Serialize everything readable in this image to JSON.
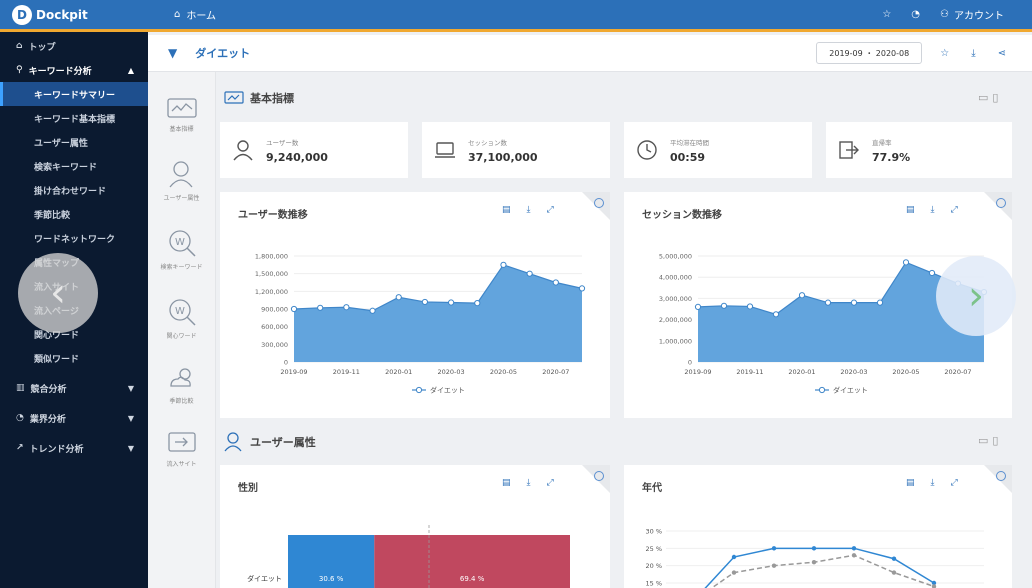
{
  "topbar": {
    "logo": "Dockpit",
    "home_label": "ホーム",
    "account_label": "アカウント"
  },
  "sidebar": {
    "items": [
      {
        "label": "トップ"
      },
      {
        "label": "キーワード分析"
      }
    ],
    "subitems": [
      "キーワードサマリー",
      "キーワード基本指標",
      "ユーザー属性",
      "検索キーワード",
      "掛け合わせワード",
      "季節比較",
      "ワードネットワーク",
      "属性マップ",
      "流入サイト",
      "流入ページ",
      "関心ワード",
      "類似ワード"
    ],
    "bottom_items": [
      "競合分析",
      "業界分析",
      "トレンド分析"
    ]
  },
  "subheader": {
    "keyword": "ダイエット",
    "date_range": "2019-09 ・ 2020-08"
  },
  "rail": [
    "基本指標",
    "ユーザー属性",
    "検索キーワード",
    "関心ワード",
    "季節比較",
    "流入サイト"
  ],
  "section1": {
    "title": "基本指標"
  },
  "metrics": [
    {
      "label": "ユーザー数",
      "value": "9,240,000"
    },
    {
      "label": "セッション数",
      "value": "37,100,000"
    },
    {
      "label": "平均滞在時間",
      "value": "00:59"
    },
    {
      "label": "直帰率",
      "value": "77.9%"
    }
  ],
  "card_users": {
    "title": "ユーザー数推移"
  },
  "card_sessions": {
    "title": "セッション数推移"
  },
  "section2": {
    "title": "ユーザー属性"
  },
  "card_gender": {
    "title": "性別"
  },
  "card_age": {
    "title": "年代"
  },
  "chart_data": [
    {
      "type": "area",
      "title": "ユーザー数推移",
      "x": [
        "2019-09",
        "2019-10",
        "2019-11",
        "2019-12",
        "2020-01",
        "2020-02",
        "2020-03",
        "2020-04",
        "2020-05",
        "2020-06",
        "2020-07",
        "2020-08"
      ],
      "x_tick_labels": [
        "2019-09",
        "2019-11",
        "2020-01",
        "2020-03",
        "2020-05",
        "2020-07"
      ],
      "y_tick_labels": [
        "0",
        "300,000",
        "600,000",
        "900,000",
        "1,200,000",
        "1,500,000",
        "1,800,000"
      ],
      "ylim": [
        0,
        1800000
      ],
      "series": [
        {
          "name": "ダイエット",
          "values": [
            900000,
            920000,
            930000,
            870000,
            1100000,
            1020000,
            1010000,
            1000000,
            1650000,
            1500000,
            1350000,
            1250000
          ]
        }
      ],
      "color": "#5a9fdb",
      "legend": "bottom"
    },
    {
      "type": "area",
      "title": "セッション数推移",
      "x": [
        "2019-09",
        "2019-10",
        "2019-11",
        "2019-12",
        "2020-01",
        "2020-02",
        "2020-03",
        "2020-04",
        "2020-05",
        "2020-06",
        "2020-07",
        "2020-08"
      ],
      "x_tick_labels": [
        "2019-09",
        "2019-11",
        "2020-01",
        "2020-03",
        "2020-05",
        "2020-07"
      ],
      "y_tick_labels": [
        "0",
        "1,000,000",
        "2,000,000",
        "3,000,000",
        "4,000,000",
        "5,000,000"
      ],
      "ylim": [
        0,
        5000000
      ],
      "series": [
        {
          "name": "ダイエット",
          "values": [
            2600000,
            2650000,
            2620000,
            2250000,
            3150000,
            2800000,
            2800000,
            2800000,
            4700000,
            4200000,
            3700000,
            3300000
          ]
        }
      ],
      "color": "#5a9fdb",
      "legend": "bottom"
    },
    {
      "type": "bar",
      "title": "性別",
      "categories": [
        "ダイエット"
      ],
      "series": [
        {
          "values": [
            30.6
          ],
          "color": "#2f87d3"
        },
        {
          "values": [
            69.4
          ],
          "color": "#c0485f"
        }
      ],
      "value_labels": [
        "30.6 %",
        "69.4 %"
      ]
    },
    {
      "type": "line",
      "title": "年代",
      "y_tick_labels": [
        "30 %",
        "25 %",
        "20 %",
        "15 %"
      ],
      "ylim": [
        15,
        30
      ],
      "series": [
        {
          "values": [
            10,
            22.5,
            25,
            25,
            25,
            22,
            15
          ],
          "color": "#2f87d3",
          "style": "solid"
        },
        {
          "values": [
            10,
            18,
            20,
            21,
            23,
            18,
            14
          ],
          "color": "#999999",
          "style": "dashed"
        }
      ]
    }
  ]
}
